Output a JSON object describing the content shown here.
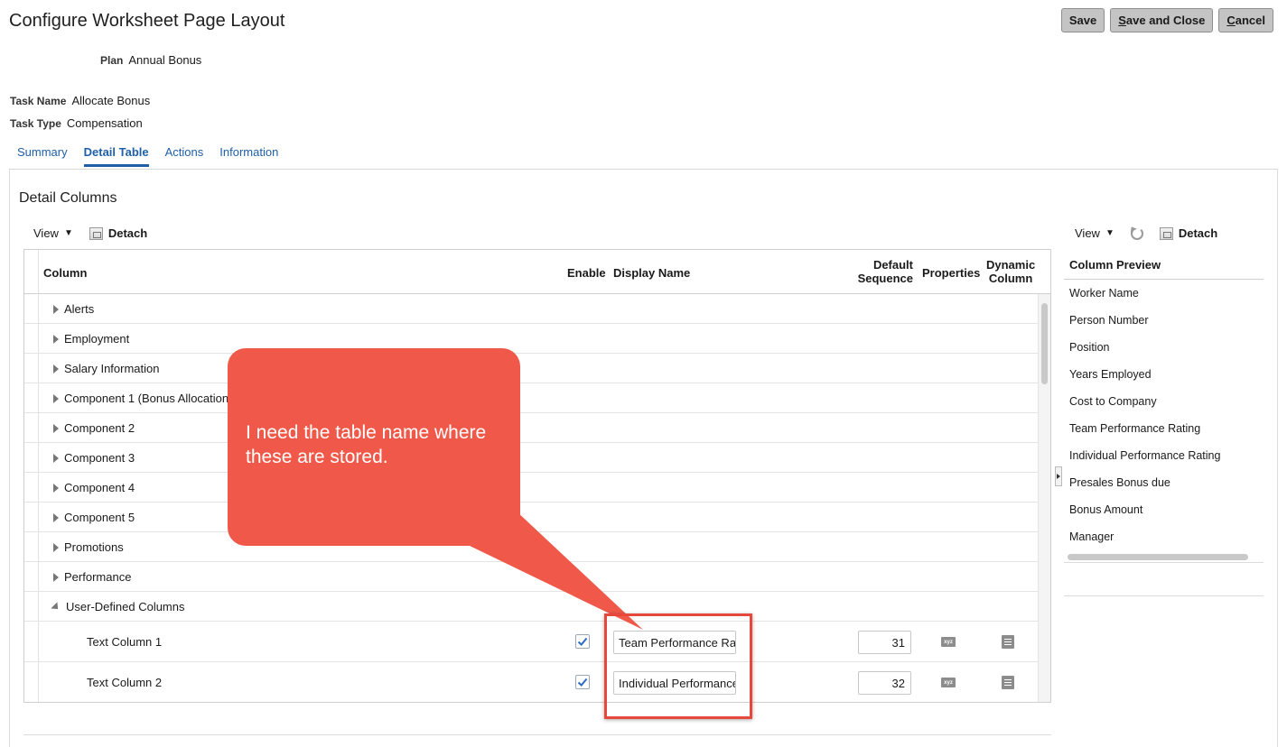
{
  "page": {
    "title": "Configure Worksheet Page Layout"
  },
  "buttons": {
    "save": "Save",
    "save_close": "Save and Close",
    "save_close_accel": "S",
    "save_close_rest": "ave and Close",
    "cancel_accel": "C",
    "cancel_rest": "ancel"
  },
  "fields": {
    "plan": {
      "label": "Plan",
      "value": "Annual Bonus"
    },
    "task_name": {
      "label": "Task Name",
      "value": "Allocate Bonus"
    },
    "task_type": {
      "label": "Task Type",
      "value": "Compensation"
    }
  },
  "tabs": [
    "Summary",
    "Detail Table",
    "Actions",
    "Information"
  ],
  "section": {
    "title": "Detail Columns"
  },
  "toolbar": {
    "view": "View",
    "detach": "Detach"
  },
  "table": {
    "headers": {
      "column": "Column",
      "enable": "Enable",
      "display_name": "Display Name",
      "default_sequence_1": "Default",
      "default_sequence_2": "Sequence",
      "properties": "Properties",
      "dynamic_1": "Dynamic",
      "dynamic_2": "Column"
    },
    "groups": [
      "Alerts",
      "Employment",
      "Salary Information",
      "Component 1 (Bonus Allocation)",
      "Component 2",
      "Component 3",
      "Component 4",
      "Component 5",
      "Promotions",
      "Performance",
      "User-Defined Columns"
    ],
    "children": [
      {
        "name": "Text Column 1",
        "display_name": "Team Performance Rati",
        "sequence": "31",
        "enabled": true
      },
      {
        "name": "Text Column 2",
        "display_name": "Individual Performance",
        "sequence": "32",
        "enabled": true
      }
    ]
  },
  "preview": {
    "header": "Column Preview",
    "items": [
      "Worker Name",
      "Person Number",
      "Position",
      "Years Employed",
      "Cost to Company",
      "Team Performance Rating",
      "Individual Performance Rating",
      "Presales Bonus due",
      "Bonus Amount",
      "Manager"
    ]
  },
  "annotation": {
    "text": "I need the table name where these are stored.",
    "color": "#f0594a"
  },
  "icons": {
    "xyz": "xyz"
  }
}
